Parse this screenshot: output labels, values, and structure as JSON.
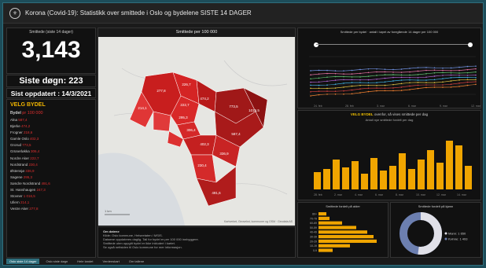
{
  "header": {
    "title": "Korona (Covid-19): Statistikk over smittede i Oslo og bydelene SISTE 14 DAGER",
    "logo_icon": "oslo-seal"
  },
  "left": {
    "smittede_label": "Smittede (siste 14 dager)",
    "total": "3,143",
    "siste_dogn": "Siste døgn: 223",
    "sist_oppdatert": "Sist oppdatert : 14/3/2021",
    "velg_bydel": "VELG BYDEL",
    "selected": {
      "label": "Bydel",
      "value": "pr 100 000"
    },
    "bydeler": [
      {
        "name": "Alna",
        "value": "587,4"
      },
      {
        "name": "Bjerke",
        "value": "474,2"
      },
      {
        "name": "Frogner",
        "value": "218,6"
      },
      {
        "name": "Gamle Oslo",
        "value": "402,3"
      },
      {
        "name": "Grorud",
        "value": "773,5"
      },
      {
        "name": "Grünerløkka",
        "value": "306,4"
      },
      {
        "name": "Nordre Aker",
        "value": "222,7"
      },
      {
        "name": "Nordstrand",
        "value": "230,4"
      },
      {
        "name": "Østensjø",
        "value": "336,9"
      },
      {
        "name": "Sagene",
        "value": "295,3"
      },
      {
        "name": "Søndre Nordstrand",
        "value": "491,6"
      },
      {
        "name": "St. Hanshaugen",
        "value": "247,3"
      },
      {
        "name": "Stovner",
        "value": "1 016,5"
      },
      {
        "name": "Ullern",
        "value": "214,1"
      },
      {
        "name": "Vestre Aker",
        "value": "277,8"
      }
    ]
  },
  "map": {
    "title": "Smittede per 100 000",
    "labels": [
      "277,8",
      "226,7",
      "214,1",
      "222,7",
      "491,6",
      "402,3",
      "336,9",
      "773,5",
      "1016,5",
      "587,4",
      "474,2",
      "295,3",
      "306,4",
      "230,4"
    ],
    "attribution": "Kartverket, Geovekst, kommuner og OSM · Geodata AS",
    "scale": "1 km",
    "colors": {
      "dark": "#a01818",
      "mid": "#c81e1e",
      "light": "#e83a3a"
    }
  },
  "info": {
    "title": "Om datene",
    "lines": [
      "Kilde: Oslo kommune, Helseetaten / MSIS.",
      "Dataene oppdateres daglig. Tall for bydel er per 100 000 innbyggere.",
      "Smittede uten oppgitt bydel er ikke inkludert i kartet.",
      "Se også nettsiden til Oslo kommune for mer informasjon."
    ]
  },
  "line_chart": {
    "title": "Smittede per bydel · antall i løpet av foregående 14 dager per 100 000",
    "x_labels": [
      "24. feb",
      "28. feb",
      "3. mar",
      "6. mar",
      "9. mar",
      "12. mar"
    ],
    "series_colors": [
      "#f08030",
      "#d04040",
      "#e0c040",
      "#40b0e0",
      "#b060d0",
      "#60c070",
      "#e070a0",
      "#7090e0"
    ]
  },
  "bar_chart": {
    "title_highlight": "VELG BYDEL",
    "title_rest": "ovenfor, så vises smittede per dag",
    "subtitle": "Antall nye smittede fordelt per dag",
    "x_labels": [
      "28. feb",
      "2. mar",
      "4. mar",
      "6. mar",
      "8. mar",
      "10. mar",
      "12. mar",
      "14. mar"
    ],
    "color": "#f0a500"
  },
  "age_chart": {
    "title": "Smittede fordelt på alder",
    "categories": [
      "80+",
      "70-79",
      "60-69",
      "50-59",
      "40-49",
      "30-39",
      "20-29",
      "10-19",
      "0-9"
    ],
    "color": "#f0a500"
  },
  "donut": {
    "title": "Smittede fordelt på kjønn",
    "legend": [
      "Mann: 1 650",
      "Kvinne: 1 493"
    ],
    "colors": [
      "#e0e0e8",
      "#6c7fb0"
    ]
  },
  "tabs": [
    "Oslo siste 14 dager",
    "Oslo siste døgn",
    "Hele landet",
    "Verdenskart",
    "Om tallene"
  ]
}
